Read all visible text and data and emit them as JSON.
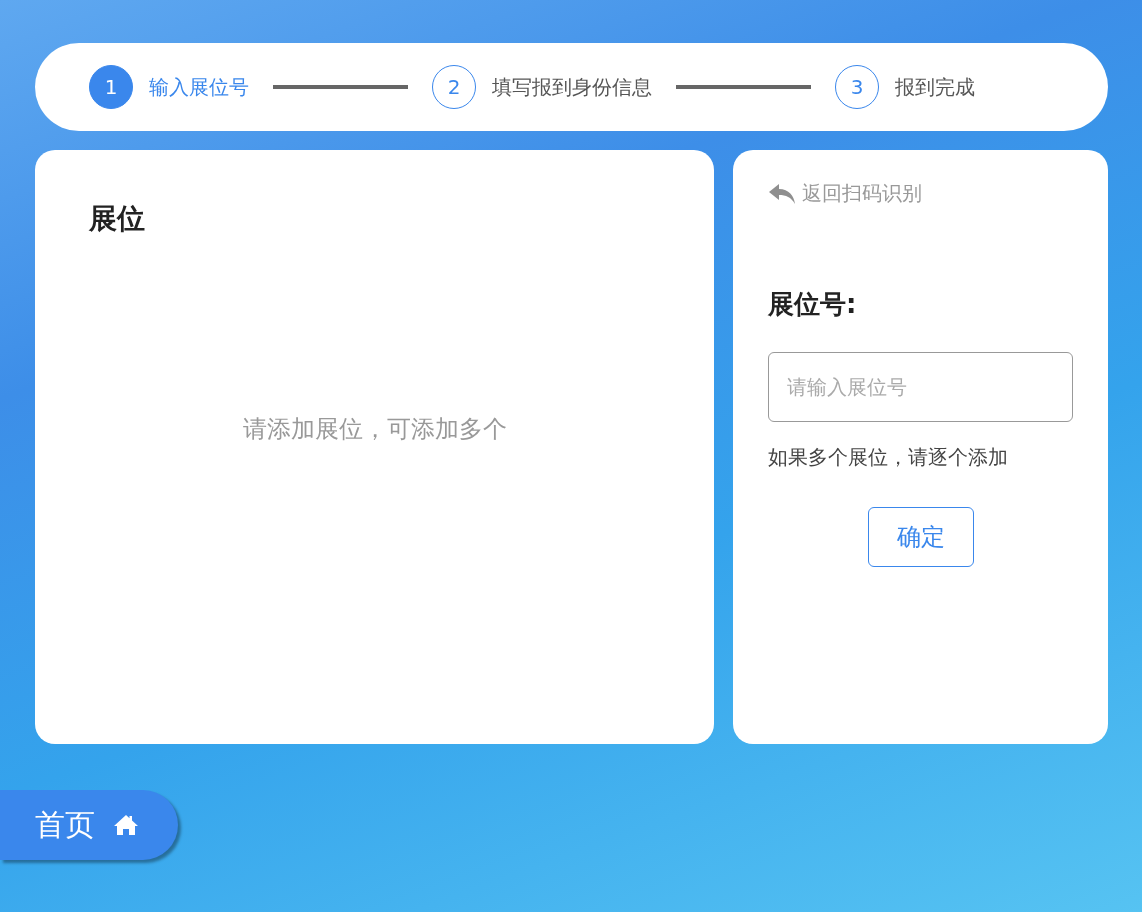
{
  "steps": [
    {
      "number": "1",
      "label": "输入展位号",
      "selected": true
    },
    {
      "number": "2",
      "label": "填写报到身份信息",
      "selected": false
    },
    {
      "number": "3",
      "label": "报到完成",
      "selected": false
    }
  ],
  "booth_panel": {
    "title": "展位",
    "empty_text": "请添加展位，可添加多个"
  },
  "entry_panel": {
    "back_link": "返回扫码识别",
    "field_label": "展位号:",
    "placeholder": "请输入展位号",
    "hint": "如果多个展位，请逐个添加",
    "confirm_button": "确定"
  },
  "home_button": "首页"
}
